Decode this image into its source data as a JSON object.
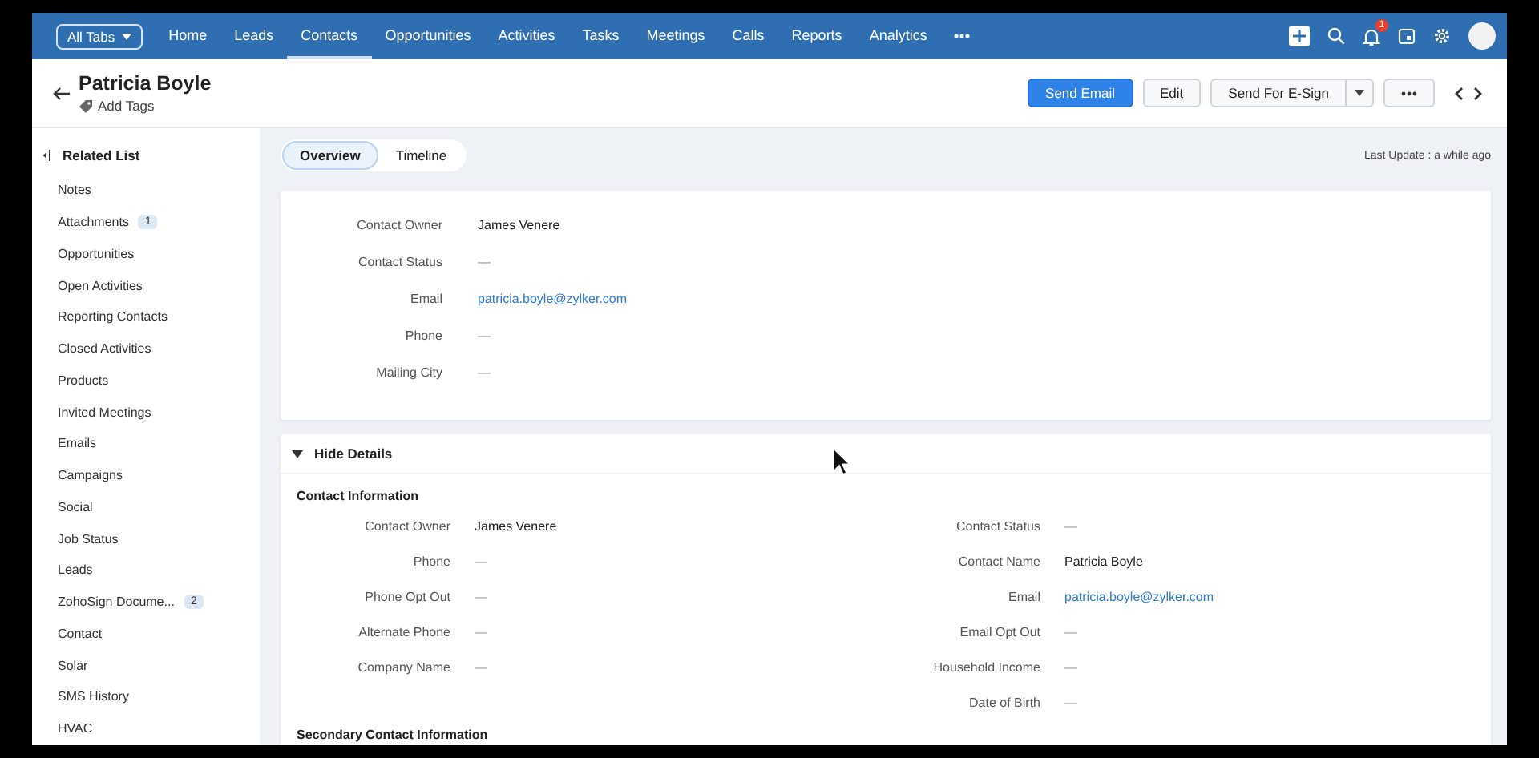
{
  "nav": {
    "all_tabs": "All Tabs",
    "tabs": [
      {
        "label": "Home",
        "selected": false
      },
      {
        "label": "Leads",
        "selected": false
      },
      {
        "label": "Contacts",
        "selected": true
      },
      {
        "label": "Opportunities",
        "selected": false
      },
      {
        "label": "Activities",
        "selected": false
      },
      {
        "label": "Tasks",
        "selected": false
      },
      {
        "label": "Meetings",
        "selected": false
      },
      {
        "label": "Calls",
        "selected": false
      },
      {
        "label": "Reports",
        "selected": false
      },
      {
        "label": "Analytics",
        "selected": false
      }
    ],
    "notification_count": "1"
  },
  "header": {
    "name": "Patricia Boyle",
    "add_tags": "Add Tags",
    "send_email": "Send Email",
    "edit": "Edit",
    "send_for_esign": "Send For E-Sign"
  },
  "sidebar": {
    "title": "Related List",
    "items": [
      {
        "label": "Notes"
      },
      {
        "label": "Attachments",
        "badge": "1"
      },
      {
        "label": "Opportunities"
      },
      {
        "label": "Open Activities"
      },
      {
        "label": "Reporting Contacts"
      },
      {
        "label": "Closed Activities"
      },
      {
        "label": "Products"
      },
      {
        "label": "Invited Meetings"
      },
      {
        "label": "Emails"
      },
      {
        "label": "Campaigns"
      },
      {
        "label": "Social"
      },
      {
        "label": "Job Status"
      },
      {
        "label": "Leads"
      },
      {
        "label": "ZohoSign Docume...",
        "badge": "2"
      },
      {
        "label": "Contact"
      },
      {
        "label": "Solar"
      },
      {
        "label": "SMS History"
      },
      {
        "label": "HVAC"
      }
    ]
  },
  "view_tabs": [
    {
      "label": "Overview",
      "selected": true
    },
    {
      "label": "Timeline",
      "selected": false
    }
  ],
  "last_update": "Last Update : a while ago",
  "summary": {
    "fields": [
      {
        "label": "Contact Owner",
        "value": "James Venere",
        "kind": "text"
      },
      {
        "label": "Contact Status",
        "value": "—",
        "kind": "empty"
      },
      {
        "label": "Email",
        "value": "patricia.boyle@zylker.com",
        "kind": "link"
      },
      {
        "label": "Phone",
        "value": "—",
        "kind": "empty"
      },
      {
        "label": "Mailing City",
        "value": "—",
        "kind": "empty"
      }
    ]
  },
  "details": {
    "toggle": "Hide Details",
    "expanded": true,
    "section_title": "Contact Information",
    "left_fields": [
      {
        "label": "Contact Owner",
        "value": "James Venere",
        "kind": "text"
      },
      {
        "label": "Phone",
        "value": "—",
        "kind": "empty"
      },
      {
        "label": "Phone Opt Out",
        "value": "—",
        "kind": "empty"
      },
      {
        "label": "Alternate Phone",
        "value": "—",
        "kind": "empty"
      },
      {
        "label": "Company Name",
        "value": "—",
        "kind": "empty"
      }
    ],
    "right_fields": [
      {
        "label": "Contact Status",
        "value": "—",
        "kind": "empty"
      },
      {
        "label": "Contact Name",
        "value": "Patricia Boyle",
        "kind": "text"
      },
      {
        "label": "Email",
        "value": "patricia.boyle@zylker.com",
        "kind": "link"
      },
      {
        "label": "Email Opt Out",
        "value": "—",
        "kind": "empty"
      },
      {
        "label": "Household Income",
        "value": "—",
        "kind": "empty"
      },
      {
        "label": "Date of Birth",
        "value": "—",
        "kind": "empty"
      }
    ],
    "next_section_title": "Secondary Contact Information"
  }
}
